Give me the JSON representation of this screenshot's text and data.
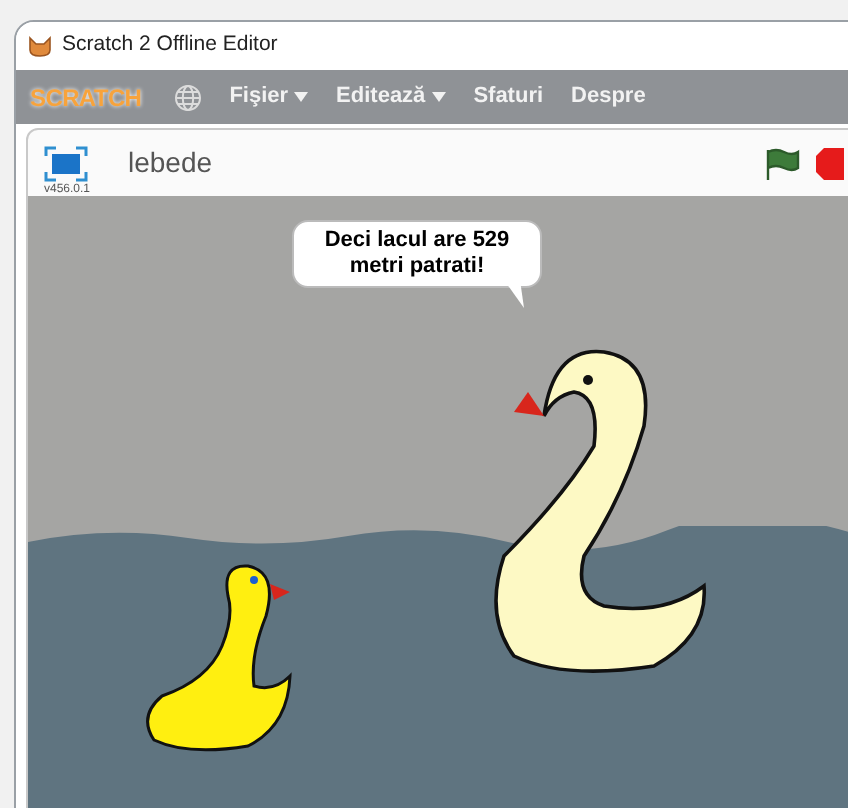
{
  "window": {
    "title": "Scratch 2 Offline Editor"
  },
  "menu": {
    "logo": "SCRATCH",
    "items": [
      {
        "label": "Fişier",
        "dropdown": true
      },
      {
        "label": "Editează",
        "dropdown": true
      },
      {
        "label": "Sfaturi",
        "dropdown": false
      },
      {
        "label": "Despre",
        "dropdown": false
      }
    ]
  },
  "stage_header": {
    "project_title": "lebede",
    "version": "v456.0.1"
  },
  "stage": {
    "speech_bubble": "Deci lacul are 529 metri patrati!"
  }
}
